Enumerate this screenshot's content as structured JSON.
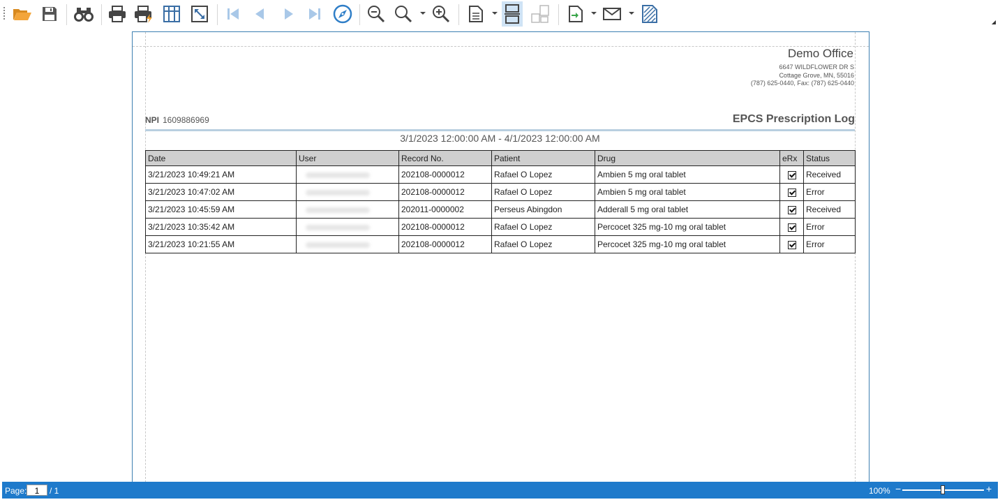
{
  "toolbar": {
    "icons": [
      "open-folder-icon",
      "save-icon",
      "find-icon",
      "print-icon",
      "quick-print-icon",
      "page-setup-icon",
      "fit-page-icon",
      "first-page-icon",
      "previous-page-icon",
      "next-page-icon",
      "last-page-icon",
      "navigate-icon",
      "zoom-out-icon",
      "zoom-icon",
      "zoom-in-icon",
      "single-page-icon",
      "continuous-page-icon",
      "multiple-pages-icon",
      "export-icon",
      "send-email-icon",
      "watermark-icon"
    ]
  },
  "report": {
    "office_name": "Demo Office",
    "address_line1": "6647 WILDFLOWER DR S",
    "address_line2": "Cottage Grove, MN, 55016",
    "phone_line": "(787) 625-0440, Fax: (787) 625-0440",
    "npi_label": "NPI",
    "npi_value": "1609886969",
    "title": "EPCS Prescription Log",
    "date_range": "3/1/2023 12:00:00 AM - 4/1/2023 12:00:00 AM",
    "columns": [
      "Date",
      "User",
      "Record No.",
      "Patient",
      "Drug",
      "eRx",
      "Status"
    ],
    "rows": [
      {
        "date": "3/21/2023 10:49:21 AM",
        "record": "202108-0000012",
        "patient": "Rafael O Lopez",
        "drug": "Ambien 5 mg oral tablet",
        "erx": true,
        "status": "Received"
      },
      {
        "date": "3/21/2023 10:47:02 AM",
        "record": "202108-0000012",
        "patient": "Rafael O Lopez",
        "drug": "Ambien 5 mg oral tablet",
        "erx": true,
        "status": "Error"
      },
      {
        "date": "3/21/2023 10:45:59 AM",
        "record": "202011-0000002",
        "patient": "Perseus Abingdon",
        "drug": "Adderall 5 mg oral tablet",
        "erx": true,
        "status": "Received"
      },
      {
        "date": "3/21/2023 10:35:42 AM",
        "record": "202108-0000012",
        "patient": "Rafael O Lopez",
        "drug": "Percocet 325 mg-10 mg oral tablet",
        "erx": true,
        "status": "Error"
      },
      {
        "date": "3/21/2023 10:21:55 AM",
        "record": "202108-0000012",
        "patient": "Rafael O Lopez",
        "drug": "Percocet 325 mg-10 mg oral tablet",
        "erx": true,
        "status": "Error"
      }
    ]
  },
  "statusbar": {
    "page_label": "Page:",
    "current_page": "1",
    "page_total": "/ 1",
    "zoom": "100%",
    "zoom_minus": "−",
    "zoom_plus": "+"
  },
  "colors": {
    "accent": "#1e7acb",
    "header_fill": "#cfcfcf",
    "folder": "#f0a33a",
    "nav_disabled": "#a9c8e8"
  }
}
